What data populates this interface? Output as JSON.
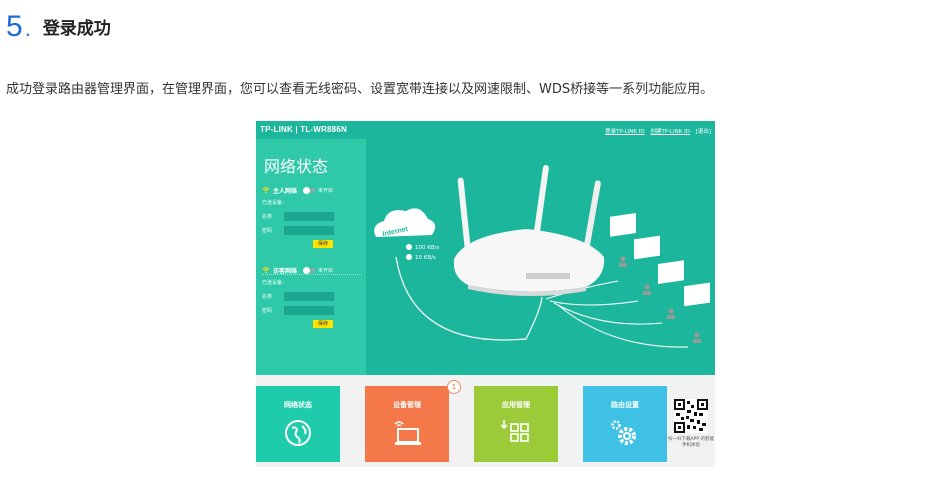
{
  "step": {
    "number": "5",
    "dot": ".",
    "title": "登录成功"
  },
  "description": "成功登录路由器管理界面，在管理界面，您可以查看无线密码、设置宽带连接以及网速限制、WDS桥接等一系列功能应用。",
  "router_ui": {
    "brand": "TP-LINK | TL-WR886N",
    "top_links": [
      "登录TP-LINK ID",
      "创建TP-LINK ID",
      "[退出]"
    ],
    "panel_title": "网络状态",
    "main_network": {
      "title": "主人网络",
      "toggle_label": "未开启",
      "connected_label": "已连设备：",
      "name_label": "名称",
      "password_label": "密码",
      "save_label": "保存"
    },
    "guest_network": {
      "title": "访客网络",
      "toggle_label": "未开启",
      "connected_label": "已连设备：",
      "name_label": "名称",
      "password_label": "密码",
      "save_label": "保存"
    },
    "internet": {
      "cloud_label": "Internet",
      "upload": "100 KB/s",
      "download": "10 KB/s"
    },
    "tiles": [
      {
        "label": "网络状态",
        "icon": "globe-icon",
        "color": "#1ecbaa"
      },
      {
        "label": "设备管理",
        "icon": "laptop-wifi-icon",
        "color": "#f5784a",
        "badge": "1"
      },
      {
        "label": "应用管理",
        "icon": "apps-grid-icon",
        "color": "#9ccb3a"
      },
      {
        "label": "路由设置",
        "icon": "gears-icon",
        "color": "#3fc1e6"
      }
    ],
    "qr_caption": "扫一扫下载APP 的智能手机体验"
  },
  "colors": {
    "accent_blue": "#1e6bd6",
    "bg_teal": "#1cb69d",
    "panel_teal": "#2fc9a9",
    "save_yellow": "#ffe100"
  }
}
